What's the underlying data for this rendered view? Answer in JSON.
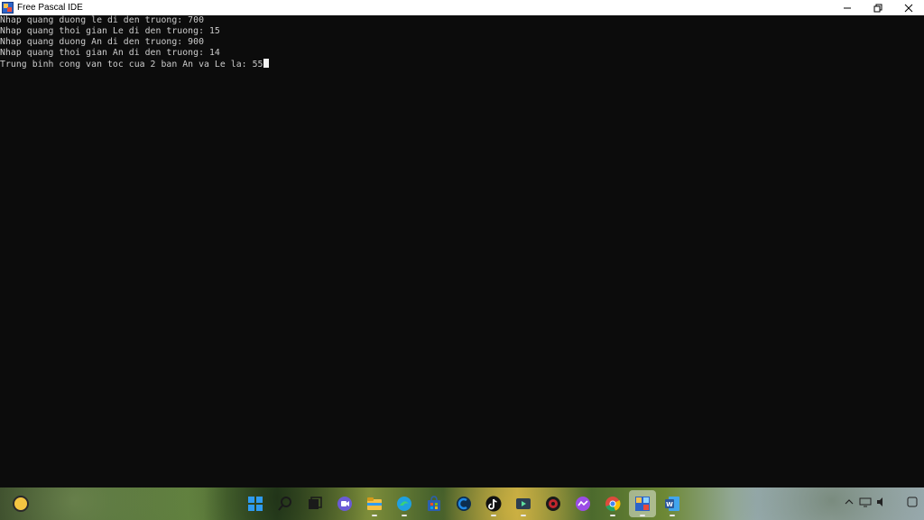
{
  "window": {
    "title": "Free Pascal IDE"
  },
  "console": {
    "lines": [
      "Nhap quang duong le di den truong: 700",
      "Nhap quang thoi gian Le di den truong: 15",
      "Nhap quang duong An di den truong: 900",
      "Nhap quang thoi gian An di den truong: 14",
      "Trung binh cong van toc cua 2 ban An va Le la: 55"
    ]
  },
  "taskbar": {
    "icons": [
      {
        "name": "windows-start-icon",
        "color": "#2f9bf0"
      },
      {
        "name": "search-icon",
        "color": "#1a1a1a"
      },
      {
        "name": "task-view-icon",
        "color": "#1a1a1a"
      },
      {
        "name": "chat-icon",
        "color": "#6b5bd6"
      },
      {
        "name": "file-explorer-icon",
        "color": "#f5c044"
      },
      {
        "name": "edge-icon",
        "color": "#1fa0e0"
      },
      {
        "name": "store-icon",
        "color": "#2b5fb0"
      },
      {
        "name": "ccleaner-icon",
        "color": "#1e88e5"
      },
      {
        "name": "tiktok-icon",
        "color": "#111111"
      },
      {
        "name": "media-app-icon",
        "color": "#2c3e50"
      },
      {
        "name": "antivirus-icon",
        "color": "#c0262d"
      },
      {
        "name": "messenger-icon",
        "color": "#9b4de6"
      },
      {
        "name": "chrome-icon",
        "color": "#dd4b3d"
      },
      {
        "name": "free-pascal-icon",
        "color": "#2b63c9"
      },
      {
        "name": "word-icon",
        "color": "#2b579a"
      }
    ]
  },
  "colors": {
    "console_bg": "#0c0c0c",
    "console_text": "#cccccc",
    "titlebar_bg": "#ffffff"
  }
}
